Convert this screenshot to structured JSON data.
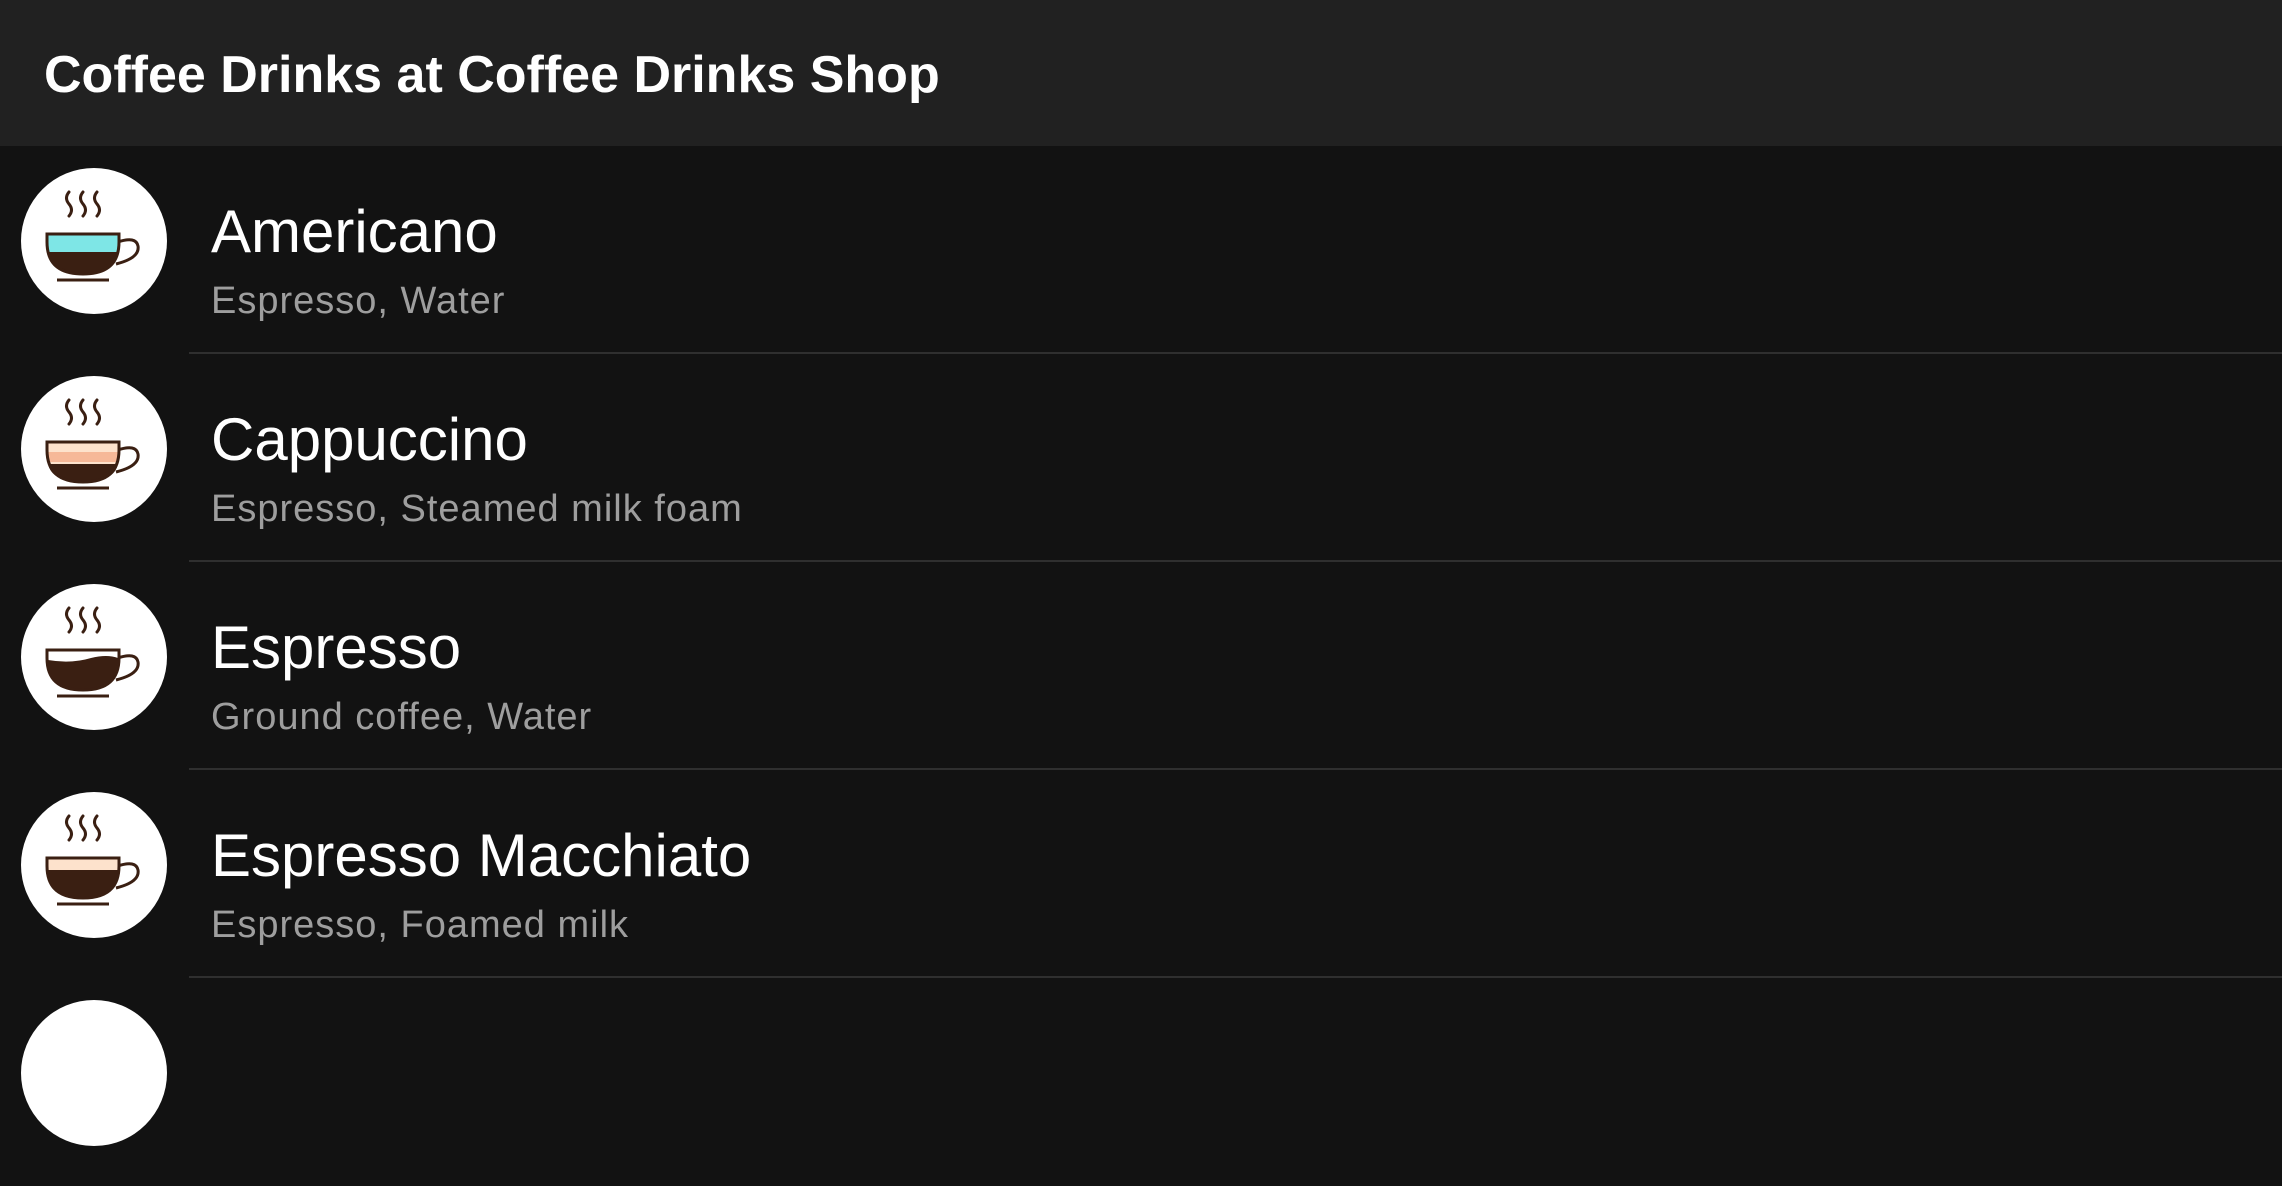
{
  "app_bar": {
    "title": "Coffee Drinks at Coffee Drinks Shop"
  },
  "list": {
    "items": [
      {
        "title": "Americano",
        "subtitle": "Espresso, Water",
        "icon": "coffee-cup-icon",
        "colors": {
          "top": "#7ee6e6",
          "bottom": "#3a1f12"
        }
      },
      {
        "title": "Cappuccino",
        "subtitle": "Espresso, Steamed milk foam",
        "icon": "coffee-cup-icon",
        "colors": {
          "top": "#fde2cc",
          "middle": "#f6b898",
          "bottom": "#3a1f12"
        }
      },
      {
        "title": "Espresso",
        "subtitle": "Ground coffee, Water",
        "icon": "coffee-cup-icon",
        "colors": {
          "bottom": "#3a1f12"
        }
      },
      {
        "title": "Espresso Macchiato",
        "subtitle": "Espresso, Foamed milk",
        "icon": "coffee-cup-icon",
        "colors": {
          "top": "#fde2cc",
          "bottom": "#3a1f12"
        }
      },
      {
        "title": "",
        "subtitle": "",
        "icon": "coffee-cup-icon",
        "colors": {}
      }
    ]
  },
  "theme": {
    "background": "#121212",
    "app_bar": "#212121",
    "title_text": "#ffffff",
    "subtitle_text": "#9e9e9e",
    "divider": "#2f2f2f"
  }
}
